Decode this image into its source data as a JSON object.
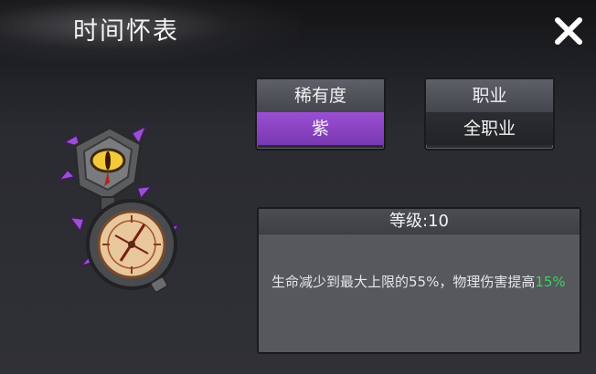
{
  "header": {
    "title": "时间怀表"
  },
  "rarity": {
    "label": "稀有度",
    "value": "紫",
    "color": "#8b44c6"
  },
  "class": {
    "label": "职业",
    "value": "全职业"
  },
  "item": {
    "icon": "pocket-watch-eye-icon",
    "level_text": "等级:10",
    "description_part1": "生命减少到最大上限的55%，物理伤害提高",
    "description_highlight": "15%",
    "highlight_color": "#3fd25a"
  }
}
